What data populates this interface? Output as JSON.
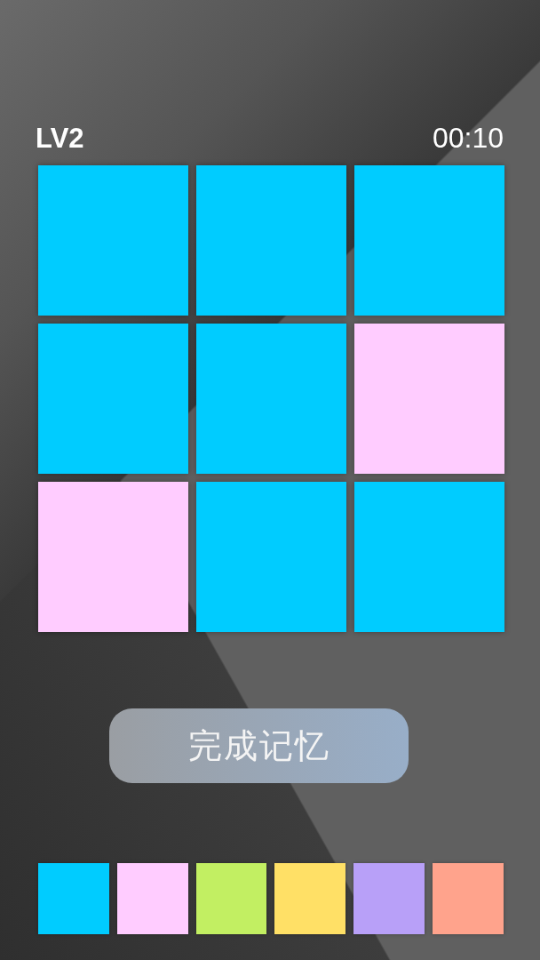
{
  "header": {
    "level": "LV2",
    "timer": "00:10"
  },
  "tiles": [
    {
      "color": "#00ccff"
    },
    {
      "color": "#00ccff"
    },
    {
      "color": "#00ccff"
    },
    {
      "color": "#00ccff"
    },
    {
      "color": "#00ccff"
    },
    {
      "color": "#ffccff"
    },
    {
      "color": "#ffccff"
    },
    {
      "color": "#00ccff"
    },
    {
      "color": "#00ccff"
    }
  ],
  "button": {
    "label": "完成记忆"
  },
  "palette": [
    {
      "color": "#00ccff"
    },
    {
      "color": "#ffccff"
    },
    {
      "color": "#c2ef62"
    },
    {
      "color": "#ffe066"
    },
    {
      "color": "#b8a0f8"
    },
    {
      "color": "#ffa38c"
    }
  ]
}
